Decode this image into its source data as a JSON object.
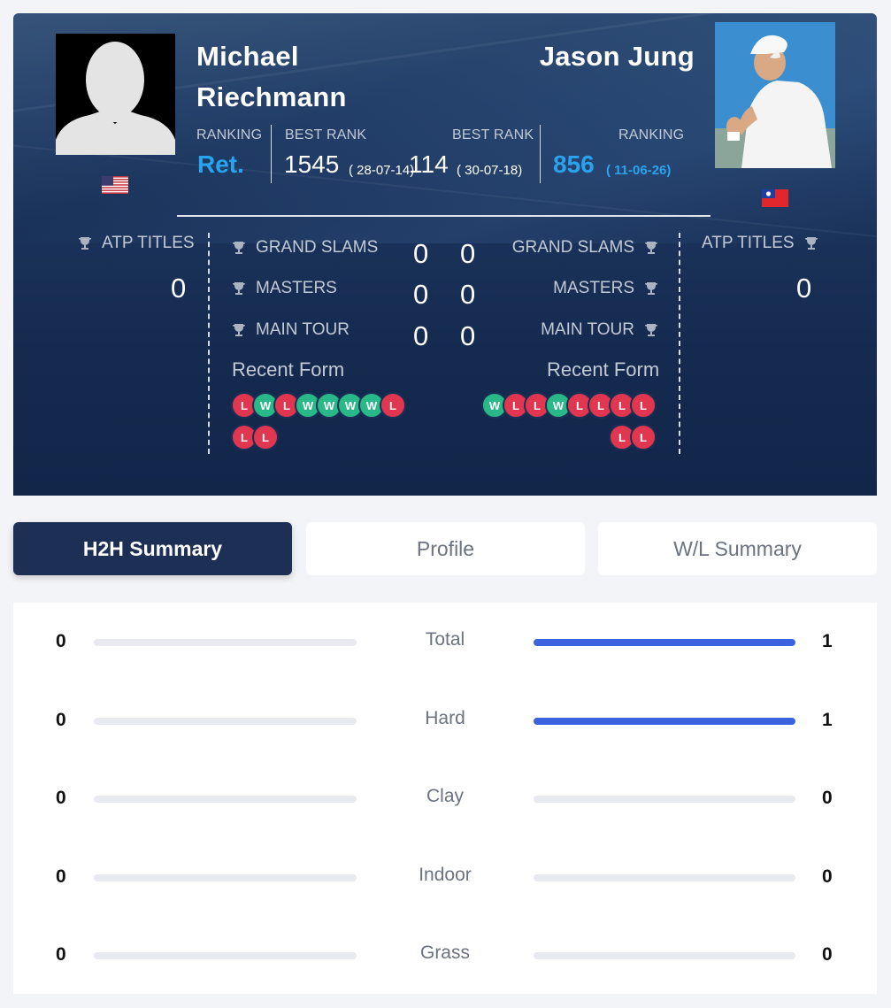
{
  "player_left": {
    "first_name": "Michael",
    "last_name": "Riechmann",
    "ranking_label": "RANKING",
    "ranking": "Ret.",
    "best_rank_label": "BEST RANK",
    "best_rank": "1545",
    "best_rank_date": "( 28-07-14)",
    "country": "USA",
    "atp_titles_label": "ATP TITLES",
    "atp_titles": "0",
    "grand_slams_label": "GRAND SLAMS",
    "grand_slams": "0",
    "masters_label": "MASTERS",
    "masters": "0",
    "main_tour_label": "MAIN TOUR",
    "main_tour": "0",
    "recent_form_label": "Recent Form",
    "recent_form": [
      "L",
      "W",
      "L",
      "W",
      "W",
      "W",
      "W",
      "L",
      "L",
      "L"
    ]
  },
  "player_right": {
    "name": "Jason Jung",
    "ranking_label": "RANKING",
    "ranking": "856",
    "ranking_date": "( 11-06-26)",
    "best_rank_label": "BEST RANK",
    "best_rank": "114",
    "best_rank_date": "( 30-07-18)",
    "country": "TPE",
    "atp_titles_label": "ATP TITLES",
    "atp_titles": "0",
    "grand_slams_label": "GRAND SLAMS",
    "grand_slams": "0",
    "masters_label": "MASTERS",
    "masters": "0",
    "main_tour_label": "MAIN TOUR",
    "main_tour": "0",
    "recent_form_label": "Recent Form",
    "recent_form": [
      "W",
      "L",
      "L",
      "W",
      "L",
      "L",
      "L",
      "L",
      "L",
      "L"
    ]
  },
  "tabs": [
    {
      "label": "H2H Summary",
      "active": true
    },
    {
      "label": "Profile",
      "active": false
    },
    {
      "label": "W/L Summary",
      "active": false
    }
  ],
  "h2h": [
    {
      "label": "Total",
      "left": "0",
      "right": "1",
      "left_fraction": 0,
      "right_fraction": 1
    },
    {
      "label": "Hard",
      "left": "0",
      "right": "1",
      "left_fraction": 0,
      "right_fraction": 1
    },
    {
      "label": "Clay",
      "left": "0",
      "right": "0",
      "left_fraction": 0,
      "right_fraction": 0
    },
    {
      "label": "Indoor",
      "left": "0",
      "right": "0",
      "left_fraction": 0,
      "right_fraction": 0
    },
    {
      "label": "Grass",
      "left": "0",
      "right": "0",
      "left_fraction": 0,
      "right_fraction": 0
    }
  ],
  "colors": {
    "header_bg": "#1b345c",
    "accent_blue": "#2aa3ee",
    "loss": "#e0364f",
    "win": "#29b988",
    "bar_fill": "#3b63e0",
    "tab_active": "#1d2f55"
  }
}
